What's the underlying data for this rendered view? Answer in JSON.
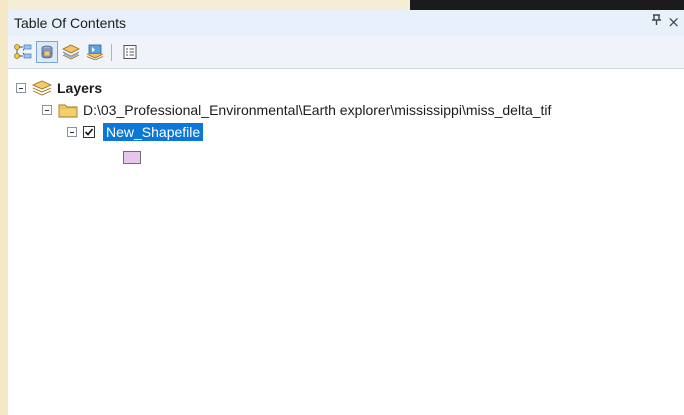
{
  "panel": {
    "title": "Table Of Contents",
    "pin_glyph": "Ԅ",
    "close_glyph": "×"
  },
  "toolbar": {
    "buttons": [
      {
        "name": "list-by-drawing-order-icon"
      },
      {
        "name": "list-by-source-icon"
      },
      {
        "name": "list-by-visibility-icon"
      },
      {
        "name": "list-by-selection-icon"
      },
      {
        "name": "options-icon"
      }
    ]
  },
  "tree": {
    "root_label": "Layers",
    "folder_label": "D:\\03_Professional_Environmental\\Earth explorer\\mississippi\\miss_delta_tif",
    "layer_label": "New_Shapefile",
    "layer_checked": true,
    "symbol_color": "#e7c6ee"
  },
  "colors": {
    "selection": "#0b77d6",
    "titlebar": "#e8f0fb"
  }
}
